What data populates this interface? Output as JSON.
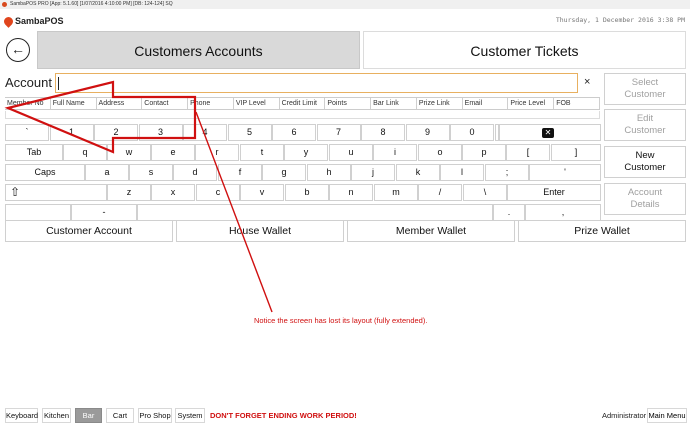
{
  "titlebar": {
    "text": "SambaPOS PRO [App: 5.1.60] [1/07/2016 4:10:00 PM] [DB: 124-124] SQ"
  },
  "brand": {
    "name": "SambaPOS",
    "datetime": "Thursday, 1 December 2016 3:38 PM"
  },
  "tabs": {
    "active": "Customers Accounts",
    "inactive": "Customer Tickets"
  },
  "account": {
    "label": "Account",
    "value": "",
    "clear": "×"
  },
  "grid": {
    "columns": [
      "Member No",
      "Full Name",
      "Address",
      "Contact",
      "Phone",
      "VIP Level",
      "Credit Limit",
      "Points",
      "Bar Link",
      "Prize Link",
      "Email",
      "Price Level",
      "FOB"
    ]
  },
  "keyboard": {
    "row1": [
      "`",
      "1",
      "2",
      "3",
      "4",
      "5",
      "6",
      "7",
      "8",
      "9",
      "0"
    ],
    "row2": [
      "Tab",
      "q",
      "w",
      "e",
      "r",
      "t",
      "y",
      "u",
      "i",
      "o",
      "p",
      "[",
      "]"
    ],
    "row3": [
      "Caps",
      "a",
      "s",
      "d",
      "f",
      "g",
      "h",
      "j",
      "k",
      "l",
      ";",
      "'"
    ],
    "row4": [
      "z",
      "x",
      "c",
      "v",
      "b",
      "n",
      "m",
      "/",
      "\\",
      "Enter"
    ],
    "row5": [
      "-",
      ".",
      ","
    ],
    "backspace_icon": "backspace-icon",
    "shift_icon": "shift-icon"
  },
  "side_buttons": [
    {
      "label_1": "Select",
      "label_2": "Customer",
      "enabled": false
    },
    {
      "label_1": "Edit",
      "label_2": "Customer",
      "enabled": false
    },
    {
      "label_1": "New",
      "label_2": "Customer",
      "enabled": true
    },
    {
      "label_1": "Account",
      "label_2": "Details",
      "enabled": false
    }
  ],
  "wallet_buttons": [
    "Customer Account",
    "House Wallet",
    "Member Wallet",
    "Prize Wallet"
  ],
  "annotation": {
    "note": "Notice the screen has lost its layout (fully extended).",
    "color": "#d01010"
  },
  "footer": {
    "tabs": [
      "Keyboard",
      "Kitchen",
      "Bar",
      "Cart",
      "Pro Shop",
      "System"
    ],
    "active_tab": "Bar",
    "warning": "DON'T FORGET ENDING WORK PERIOD!",
    "user": "Administrator",
    "main_menu": "Main Menu"
  }
}
